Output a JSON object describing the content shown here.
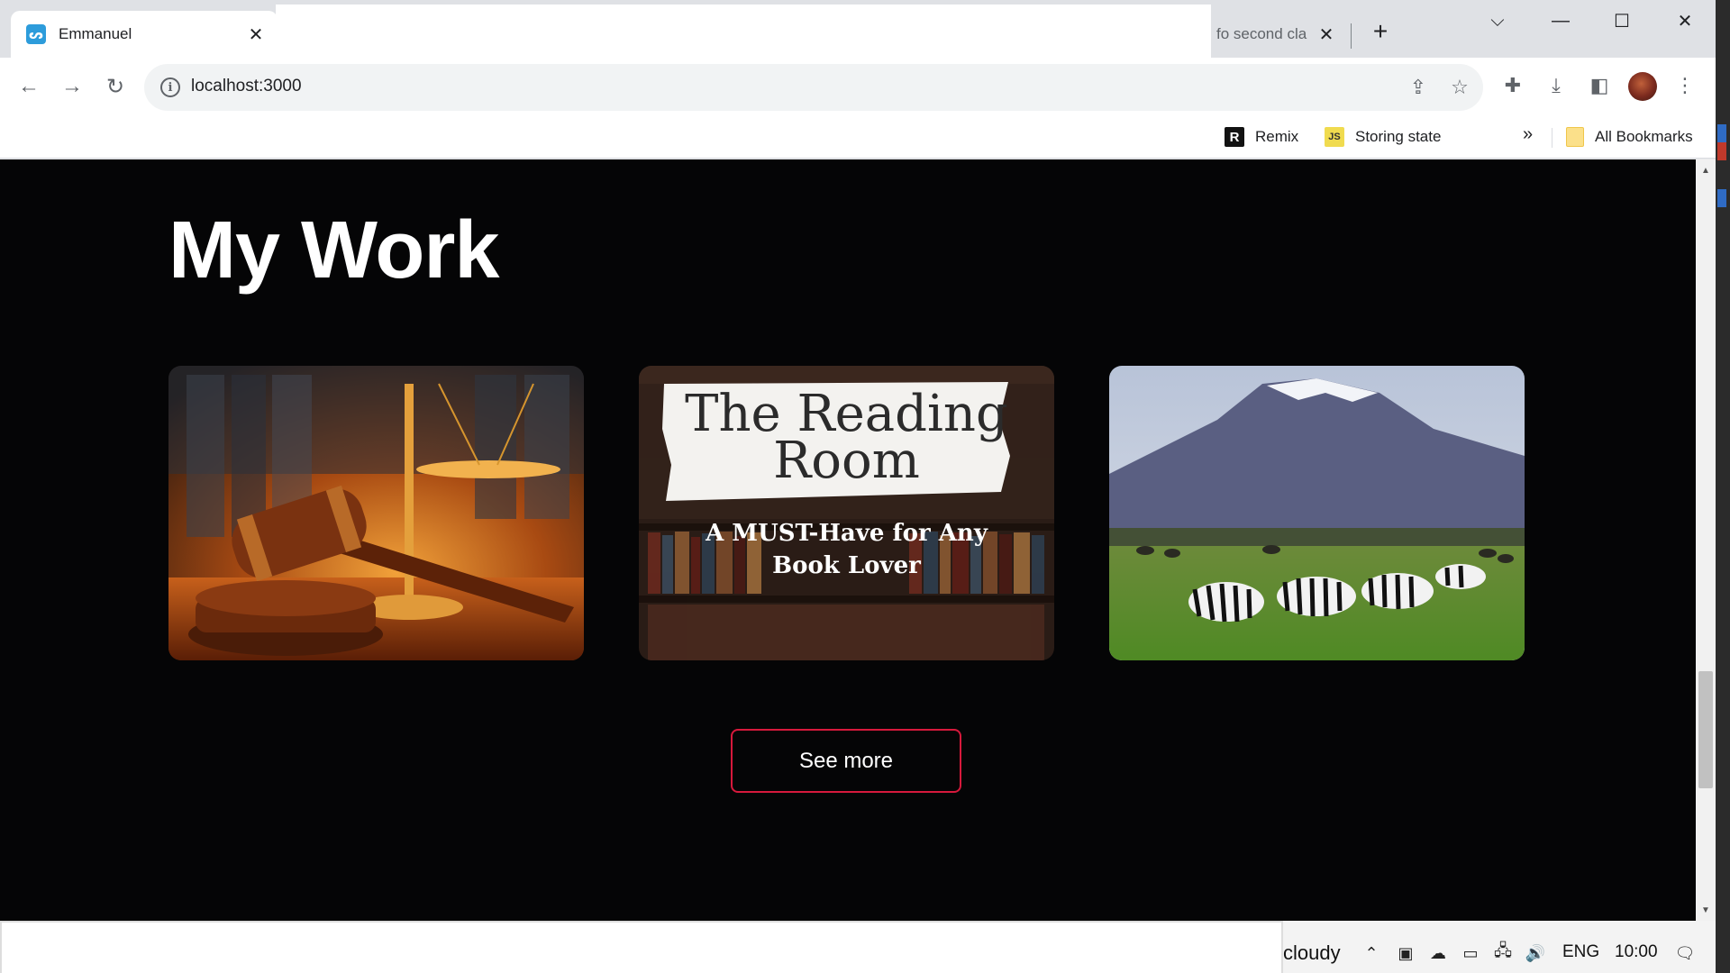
{
  "browser": {
    "tabs": [
      {
        "title": "Emmanuel",
        "favicon": "remix-logo-icon",
        "active": true
      },
      {
        "title": "fo second cla",
        "active": false
      }
    ],
    "url": "localhost:3000",
    "bookmarks": [
      {
        "label": "Remix",
        "icon": "remix-icon"
      },
      {
        "label": "Storing state",
        "icon": "js-icon"
      }
    ],
    "bookmarks_overflow": "»",
    "all_bookmarks": "All Bookmarks",
    "new_tab_symbol": "+"
  },
  "page": {
    "heading": "My Work",
    "cards": [
      {
        "name": "law-gavel-card",
        "image": "gavel and scales of justice"
      },
      {
        "name": "reading-room-card",
        "title_line1": "The Reading",
        "title_line2": "Room",
        "subtitle_line1": "A MUST-Have for Any",
        "subtitle_line2": "Book Lover"
      },
      {
        "name": "safari-card",
        "image": "zebras grazing below Mount Kilimanjaro"
      }
    ],
    "see_more_label": "See more",
    "accent_color": "#d7193c",
    "background_color": "#050506"
  },
  "taskbar": {
    "weather": "cloudy",
    "language": "ENG",
    "time": "10:00"
  }
}
